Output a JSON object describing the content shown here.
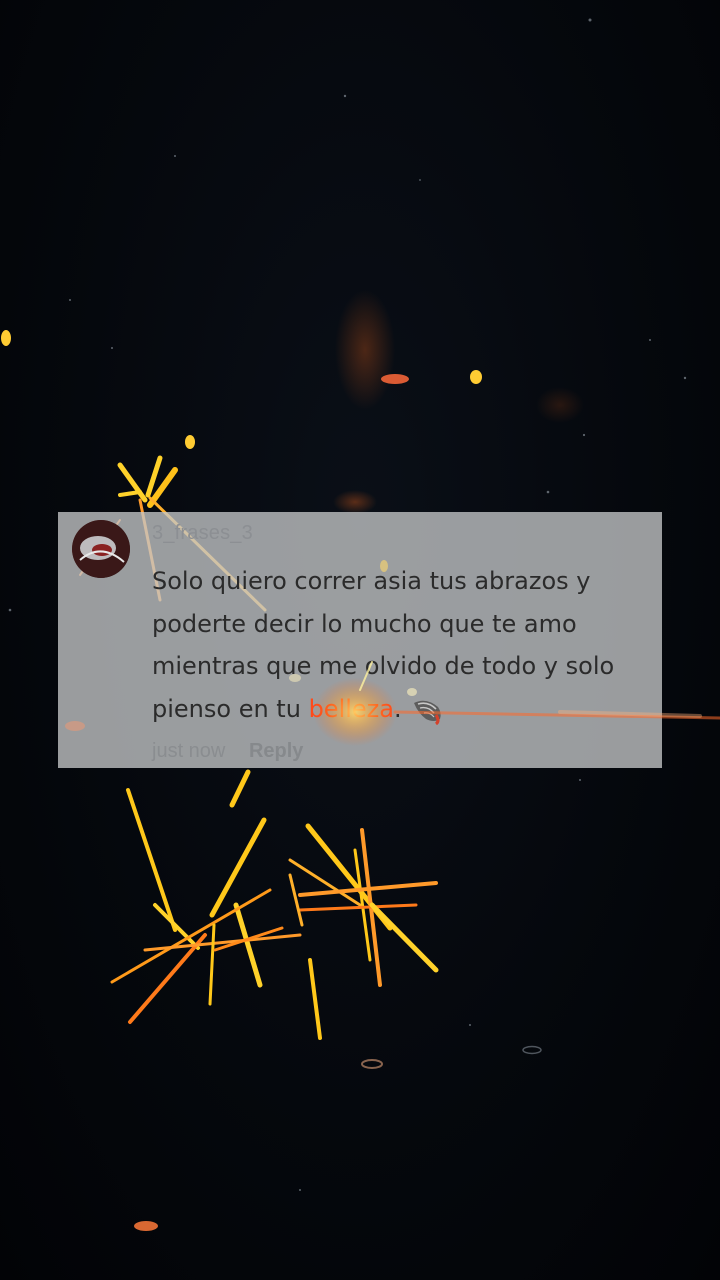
{
  "comment": {
    "username": "3_frases_3",
    "text_before_highlight": "Solo quiero correr asia tus abrazos y poderte decir lo mucho que te amo mientras que me olvido de todo y solo pienso en tu ",
    "text_highlight": "belleza",
    "text_after_highlight": ".",
    "emoji_icon": "shell-icon",
    "timestamp": "just now",
    "reply_label": "Reply"
  },
  "colors": {
    "background": "#04070c",
    "card_background": "#c4c6c8",
    "text": "#2b2b2b",
    "highlight": "#ff4a1a",
    "spark_yellow": "#ffcc1a",
    "spark_orange": "#ff7a1a"
  }
}
